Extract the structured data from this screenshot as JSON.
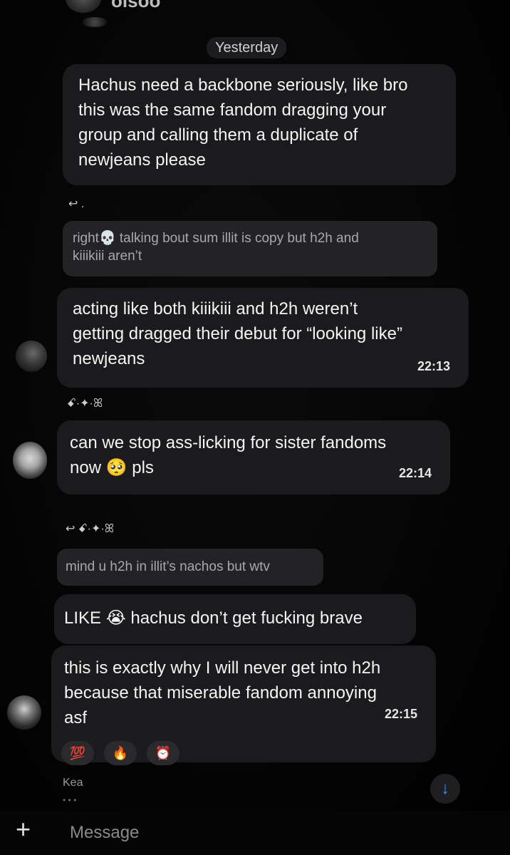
{
  "header": {
    "title": "oisoo"
  },
  "date_divider": "Yesterday",
  "messages": [
    {
      "id": "m1",
      "text": "Hachus need a backbone seriously, like bro\nthis was the same fandom dragging your\ngroup and calling them a duplicate of\nnewjeans please"
    },
    {
      "id": "m2",
      "reply_marker": "↩ .",
      "reply_preview": "right💀 talking bout sum illit is copy but h2h and\nkiiikiii aren’t",
      "text": "acting like both kiiikiii and h2h weren’t\ngetting dragged their debut for “looking like”\nnewjeans",
      "time": "22:13"
    },
    {
      "id": "m3",
      "sender_tag": "ꗃ·✦·ꕤ",
      "text": "can we stop ass-licking for sister fandoms\nnow 🥺 pls",
      "time": "22:14"
    },
    {
      "id": "m4",
      "reply_marker": "↩ ꗃ·✦·ꕤ",
      "reply_preview": "mind u h2h in illit’s nachos but wtv",
      "text": "LIKE 😭 hachus don’t get fucking brave"
    },
    {
      "id": "m5",
      "text": "this is exactly why I will never get into h2h\nbecause that miserable fandom annoying\nasf",
      "time": "22:15",
      "reactions": [
        "💯",
        "🔥",
        "⏰"
      ]
    }
  ],
  "typing": {
    "name": "Kea",
    "dots": "• • •"
  },
  "composer": {
    "placeholder": "Message",
    "plus": "+",
    "scroll_down": "↓"
  }
}
